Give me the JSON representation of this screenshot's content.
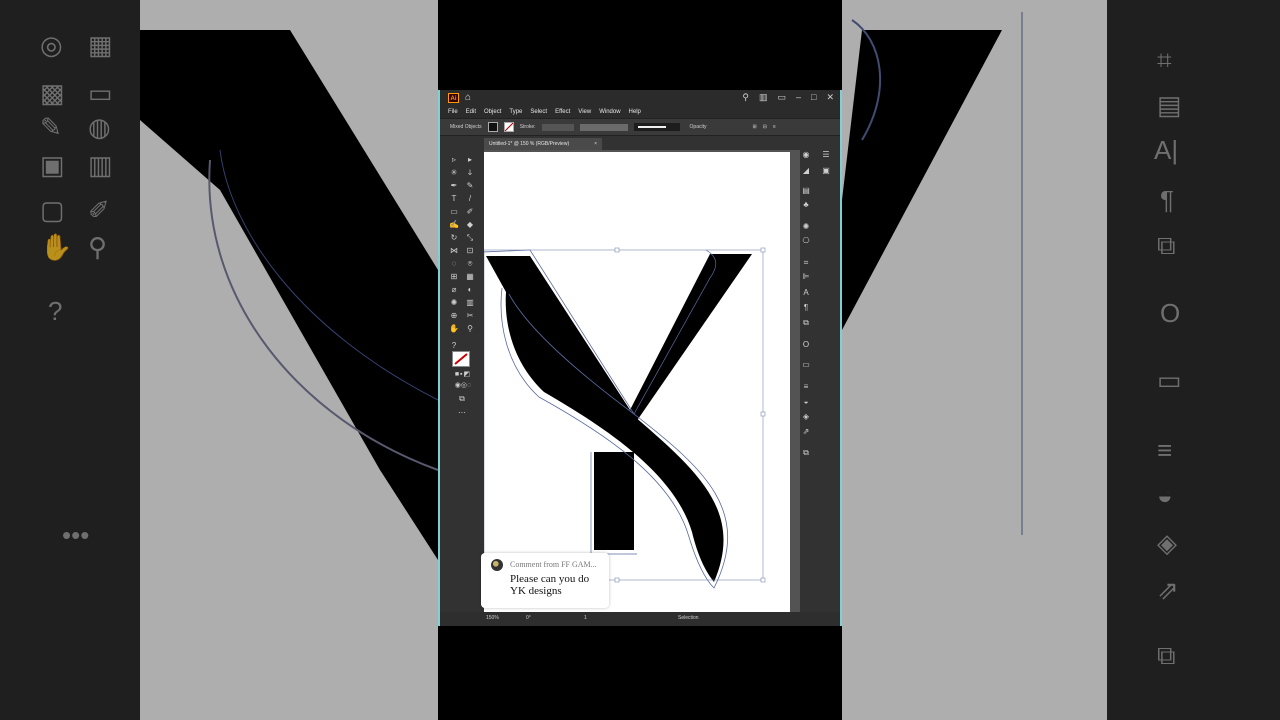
{
  "app": {
    "logo": "Ai",
    "menu": [
      "File",
      "Edit",
      "Object",
      "Type",
      "Select",
      "Effect",
      "View",
      "Window",
      "Help"
    ],
    "control_bar": {
      "selection_label": "Mixed Objects",
      "stroke_label": "Stroke:",
      "stroke_style": "Basic",
      "opacity_label": "Opacity"
    },
    "document_tab": {
      "title": "Untitled-1* @ 150 % (RGB/Preview)",
      "close": "×"
    },
    "status_bar": {
      "zoom": "150%",
      "rotation": "0°",
      "artboard": "1",
      "tool": "Selection"
    }
  },
  "overlay_comment": {
    "from": "Comment from FF GAM...",
    "message": "Please can you do YK designs"
  },
  "colors": {
    "accent_border": "#7fd0d4",
    "artwork_fill": "#000000",
    "path_outline": "#5a6aa0"
  },
  "icons": [
    "home-icon",
    "search-icon",
    "selection-tool-icon",
    "direct-selection-tool-icon",
    "pen-tool-icon",
    "type-tool-icon",
    "hand-tool-icon",
    "zoom-tool-icon"
  ]
}
